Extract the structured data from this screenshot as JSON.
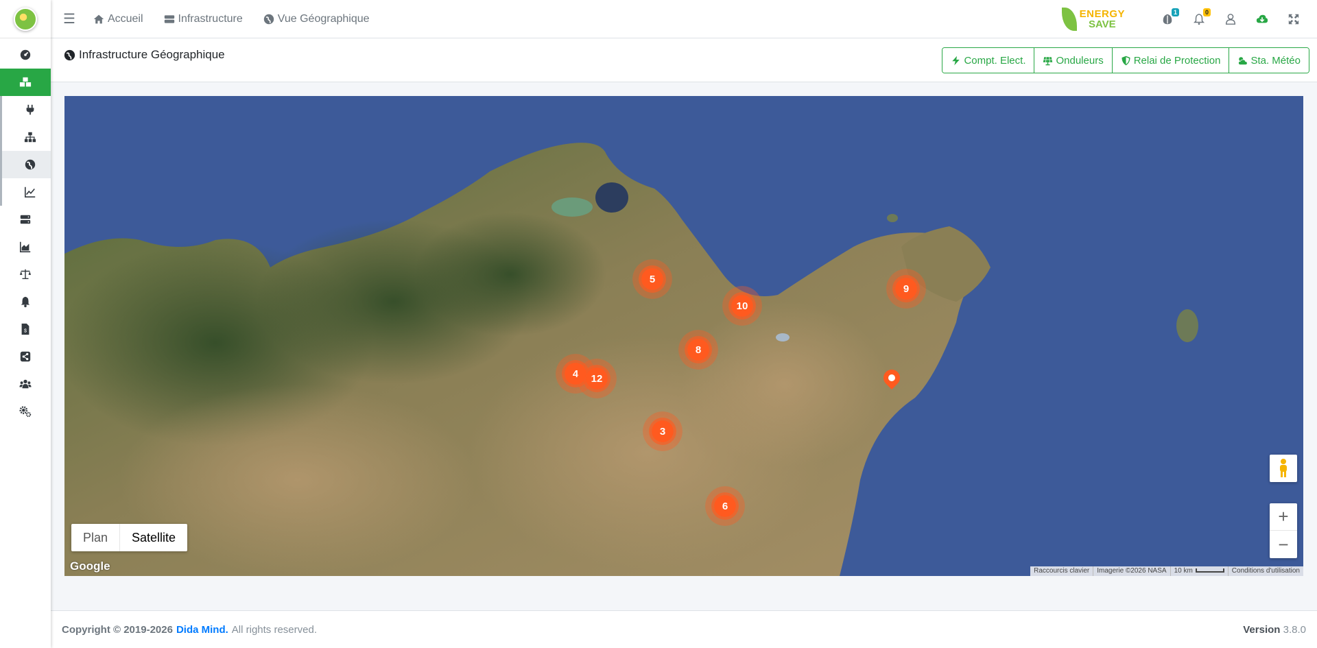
{
  "topbar": {
    "links": [
      {
        "label": "Accueil",
        "icon": "home-icon"
      },
      {
        "label": "Infrastructure",
        "icon": "server-icon"
      },
      {
        "label": "Vue Géographique",
        "icon": "globe-icon"
      }
    ],
    "brand": {
      "line1": "ENERGY",
      "line2": "SAVE"
    },
    "badges": {
      "messages": "1",
      "notifications": "0"
    }
  },
  "page": {
    "title": "Infrastructure Géographique",
    "buttons": [
      {
        "label": "Compt. Elect.",
        "icon": "bolt-icon"
      },
      {
        "label": "Onduleurs",
        "icon": "solar-panel-icon"
      },
      {
        "label": "Relai de Protection",
        "icon": "shield-icon"
      },
      {
        "label": "Sta. Météo",
        "icon": "cloud-sun-icon"
      }
    ]
  },
  "map": {
    "type_controls": {
      "plan": "Plan",
      "satellite": "Satellite",
      "selected": "Satellite"
    },
    "google_logo": "Google",
    "clusters": [
      "5",
      "10",
      "9",
      "8",
      "4",
      "12",
      "3",
      "6"
    ],
    "attribution": {
      "shortcuts": "Raccourcis clavier",
      "imagery": "Imagerie ©2026 NASA",
      "scale": "10 km",
      "terms": "Conditions d'utilisation"
    },
    "zoom_in": "+",
    "zoom_out": "−"
  },
  "footer": {
    "copyright": "Copyright © 2019-2026",
    "company": "Dida Mind.",
    "rights": "All rights reserved.",
    "version_label": "Version",
    "version": "3.8.0"
  },
  "colors": {
    "accent": "#28a745",
    "cluster": "#ff5a1f",
    "sea": "#3d5a99"
  }
}
